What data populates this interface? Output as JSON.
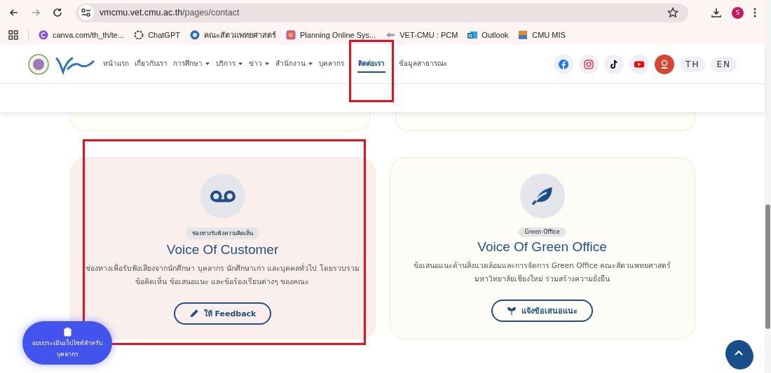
{
  "browser": {
    "url_host": "vmcmu.vet.cmu.ac.th",
    "url_path": "/pages/contact",
    "profile": "S",
    "bookmarks": [
      {
        "label": "canva.com/th_th/te...",
        "kind": "canva"
      },
      {
        "label": "ChatGPT",
        "kind": "chatgpt"
      },
      {
        "label": "คณะสัตวแพทยศาสตร์",
        "kind": "faculty"
      },
      {
        "label": "Planning Online Sys...",
        "kind": "planning"
      },
      {
        "label": "VET-CMU : PCM",
        "kind": "pcm"
      },
      {
        "label": "Outlook",
        "kind": "outlook"
      },
      {
        "label": "CMU MIS",
        "kind": "cmumis"
      }
    ]
  },
  "nav": {
    "items": [
      {
        "label": "หน้าแรก",
        "dropdown": false,
        "selected": false,
        "annotated": false
      },
      {
        "label": "เกี่ยวกับเรา",
        "dropdown": false,
        "selected": false,
        "annotated": false
      },
      {
        "label": "การศึกษา",
        "dropdown": true,
        "selected": false,
        "annotated": false
      },
      {
        "label": "บริการ",
        "dropdown": true,
        "selected": false,
        "annotated": false
      },
      {
        "label": "ข่าว",
        "dropdown": true,
        "selected": false,
        "annotated": false
      },
      {
        "label": "สำนักงาน",
        "dropdown": true,
        "selected": false,
        "annotated": false
      },
      {
        "label": "บุคลากร",
        "dropdown": false,
        "selected": false,
        "annotated": false
      },
      {
        "label": "ติดต่อเรา",
        "dropdown": false,
        "selected": true,
        "annotated": true
      },
      {
        "label": "ข้อมูลสาธารณะ",
        "dropdown": false,
        "selected": false,
        "annotated": false
      }
    ],
    "social": [
      {
        "kind": "facebook"
      },
      {
        "kind": "instagram"
      },
      {
        "kind": "tiktok"
      },
      {
        "kind": "youtube"
      },
      {
        "kind": "contact"
      }
    ],
    "languages": [
      "TH",
      "EN"
    ]
  },
  "cards": [
    {
      "kind": "customer",
      "tag": "ช่องทางรับฟังความคิดเห็น",
      "title": "Voice Of Customer",
      "description": "ช่องทางเพื่อรับฟังเสียงจากนักศึกษา บุคลากร นักศึกษาเก่า และบุคคลทั่วไป โดยรวบรวม ข้อคิดเห็น ข้อเสนอแนะ และข้อร้องเรียนต่างๆ ของคณะ",
      "button": {
        "label": "ให้ Feedback"
      },
      "annotated": true
    },
    {
      "kind": "green",
      "tag": "Green Office",
      "title": "Voice Of Green Office",
      "description": "ข้อเสนอแนะด้านสิ่งแวดล้อมและการจัดการ Green Office คณะสัตวแพทยศาสตร์ มหาวิทยาลัยเชียงใหม่ ร่วมสร้างความยั่งยืน",
      "button": {
        "label": "แจ้งข้อเสนอแนะ"
      },
      "annotated": false
    }
  ],
  "floating_button": {
    "lines": [
      "แบบประเมินเว็บไซต์สำหรับ",
      "บุคลากร"
    ]
  }
}
